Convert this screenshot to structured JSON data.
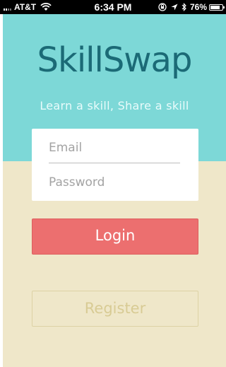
{
  "status_bar": {
    "carrier": "AT&T",
    "time": "6:34 PM",
    "battery_percent": "76%",
    "icons": [
      "signal-icon",
      "wifi-icon",
      "lock-rotation-icon",
      "location-icon",
      "bluetooth-icon",
      "battery-icon"
    ]
  },
  "app": {
    "title": "SkillSwap",
    "tagline": "Learn a skill, Share a skill"
  },
  "login_form": {
    "email_placeholder": "Email",
    "email_value": "",
    "password_placeholder": "Password",
    "password_value": "",
    "login_label": "Login",
    "register_label": "Register"
  },
  "colors": {
    "header_background": "#7dd8d7",
    "body_background": "#efe7c9",
    "logo_text": "#1b6a76",
    "login_button": "#ec6f6f",
    "register_text": "#d8cb94"
  }
}
